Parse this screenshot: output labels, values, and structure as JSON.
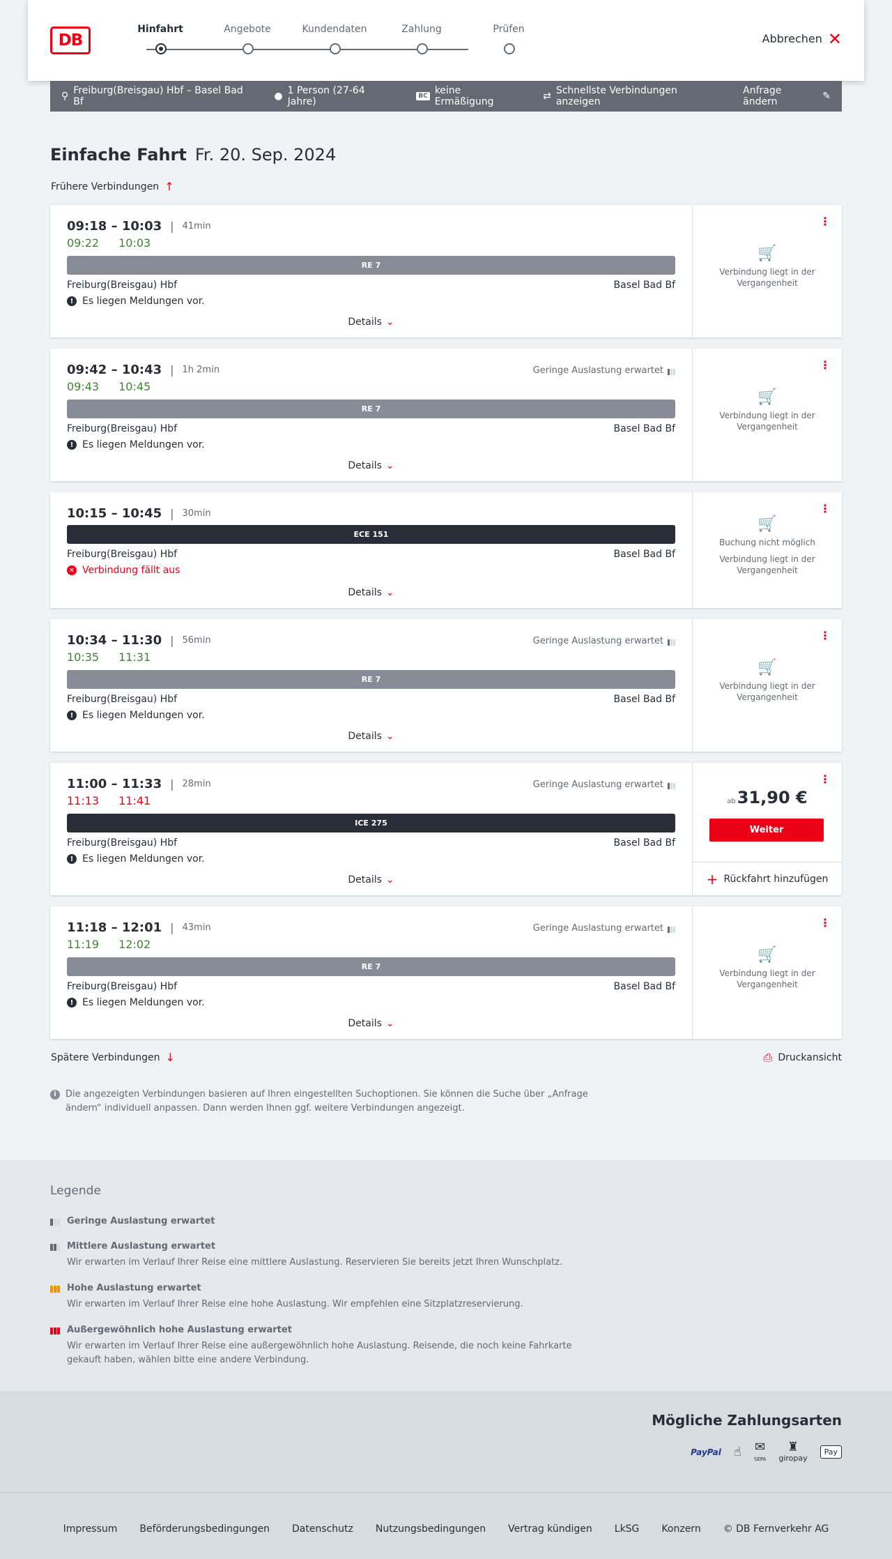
{
  "header": {
    "logo": "DB",
    "steps": [
      "Hinfahrt",
      "Angebote",
      "Kundendaten",
      "Zahlung",
      "Prüfen"
    ],
    "cancel_label": "Abbrechen"
  },
  "summary": {
    "route": "Freiburg(Breisgau) Hbf – Basel Bad Bf",
    "passengers": "1 Person (27-64 Jahre)",
    "bc_badge": "BC",
    "discount": "keine Ermäßigung",
    "fastest": "Schnellste Verbindungen anzeigen",
    "change_label": "Anfrage ändern"
  },
  "page": {
    "title": "Einfache Fahrt",
    "date": "Fr. 20. Sep. 2024",
    "earlier_label": "Frühere Verbindungen",
    "later_label": "Spätere Verbindungen",
    "print_label": "Druckansicht",
    "info_note": "Die angezeigten Verbindungen basieren auf Ihren eingestellten Suchoptionen. Sie können die Suche über „Anfrage ändern“ individuell anpassen. Dann werden Ihnen ggf. weitere Verbindungen angezeigt."
  },
  "connections": [
    {
      "times": "09:18 – 10:03",
      "duration": "41min",
      "occupancy": "",
      "rt_dep": "09:22",
      "rt_arr": "10:03",
      "rt_dep_color": "green",
      "rt_arr_color": "green",
      "train": "RE 7",
      "train_type": "re",
      "from": "Freiburg(Breisgau) Hbf",
      "to": "Basel Bad Bf",
      "message": "Es liegen Meldungen vor.",
      "message_type": "info",
      "details_label": "Details",
      "status1": "",
      "status2": "Verbindung liegt in der Vergangenheit"
    },
    {
      "times": "09:42 – 10:43",
      "duration": "1h 2min",
      "occupancy": "Geringe Auslastung erwartet",
      "rt_dep": "09:43",
      "rt_arr": "10:45",
      "rt_dep_color": "green",
      "rt_arr_color": "green",
      "train": "RE 7",
      "train_type": "re",
      "from": "Freiburg(Breisgau) Hbf",
      "to": "Basel Bad Bf",
      "message": "Es liegen Meldungen vor.",
      "message_type": "info",
      "details_label": "Details",
      "status1": "",
      "status2": "Verbindung liegt in der Vergangenheit"
    },
    {
      "times": "10:15 – 10:45",
      "duration": "30min",
      "occupancy": "",
      "rt_dep": "",
      "rt_arr": "",
      "rt_dep_color": "green",
      "rt_arr_color": "green",
      "train": "ECE 151",
      "train_type": "ice",
      "from": "Freiburg(Breisgau) Hbf",
      "to": "Basel Bad Bf",
      "message": "Verbindung fällt aus",
      "message_type": "cancel",
      "details_label": "Details",
      "status1": "Buchung nicht möglich",
      "status2": "Verbindung liegt in der Vergangenheit"
    },
    {
      "times": "10:34 – 11:30",
      "duration": "56min",
      "occupancy": "Geringe Auslastung erwartet",
      "rt_dep": "10:35",
      "rt_arr": "11:31",
      "rt_dep_color": "green",
      "rt_arr_color": "green",
      "train": "RE 7",
      "train_type": "re",
      "from": "Freiburg(Breisgau) Hbf",
      "to": "Basel Bad Bf",
      "message": "Es liegen Meldungen vor.",
      "message_type": "info",
      "details_label": "Details",
      "status1": "",
      "status2": "Verbindung liegt in der Vergangenheit"
    },
    {
      "times": "11:00 – 11:33",
      "duration": "28min",
      "occupancy": "Geringe Auslastung erwartet",
      "rt_dep": "11:13",
      "rt_arr": "11:41",
      "rt_dep_color": "red",
      "rt_arr_color": "red",
      "train": "ICE 275",
      "train_type": "ice",
      "from": "Freiburg(Breisgau) Hbf",
      "to": "Basel Bad Bf",
      "message": "Es liegen Meldungen vor.",
      "message_type": "info",
      "details_label": "Details",
      "price_prefix": "ab",
      "price": "31,90 €",
      "book_label": "Weiter",
      "return_label": "Rückfahrt hinzufügen"
    },
    {
      "times": "11:18 – 12:01",
      "duration": "43min",
      "occupancy": "Geringe Auslastung erwartet",
      "rt_dep": "11:19",
      "rt_arr": "12:02",
      "rt_dep_color": "green",
      "rt_arr_color": "green",
      "train": "RE 7",
      "train_type": "re",
      "from": "Freiburg(Breisgau) Hbf",
      "to": "Basel Bad Bf",
      "message": "Es liegen Meldungen vor.",
      "message_type": "info",
      "details_label": "Details",
      "status1": "",
      "status2": "Verbindung liegt in der Vergangenheit"
    }
  ],
  "legend": {
    "title": "Legende",
    "items": [
      {
        "title": "Geringe Auslastung erwartet",
        "desc": "",
        "level": "g"
      },
      {
        "title": "Mittlere Auslastung erwartet",
        "desc": "Wir erwarten im Verlauf Ihrer Reise eine mittlere Auslastung. Reservieren Sie bereits jetzt Ihren Wunschplatz.",
        "level": "m"
      },
      {
        "title": "Hohe Auslastung erwartet",
        "desc": "Wir erwarten im Verlauf Ihrer Reise eine hohe Auslastung. Wir empfehlen eine Sitzplatzreservierung.",
        "level": "h"
      },
      {
        "title": "Außergewöhnlich hohe Auslastung erwartet",
        "desc": "Wir erwarten im Verlauf Ihrer Reise eine außergewöhnlich hohe Auslastung. Reisende, die noch keine Fahrkarte gekauft haben, wählen bitte eine andere Verbindung.",
        "level": "x"
      }
    ]
  },
  "payments": {
    "title": "Mögliche Zahlungsarten",
    "methods": [
      "PayPal",
      "",
      "SEPA",
      "giropay",
      "Pay"
    ]
  },
  "footer": {
    "links": [
      "Impressum",
      "Beförderungsbedingungen",
      "Datenschutz",
      "Nutzungsbedingungen",
      "Vertrag kündigen",
      "LkSG",
      "Konzern",
      "© DB Fernverkehr AG"
    ]
  },
  "colors": {
    "accent": "#ec0016",
    "ontime": "#408335",
    "dark": "#282d37",
    "bar_gray": "#646973"
  }
}
